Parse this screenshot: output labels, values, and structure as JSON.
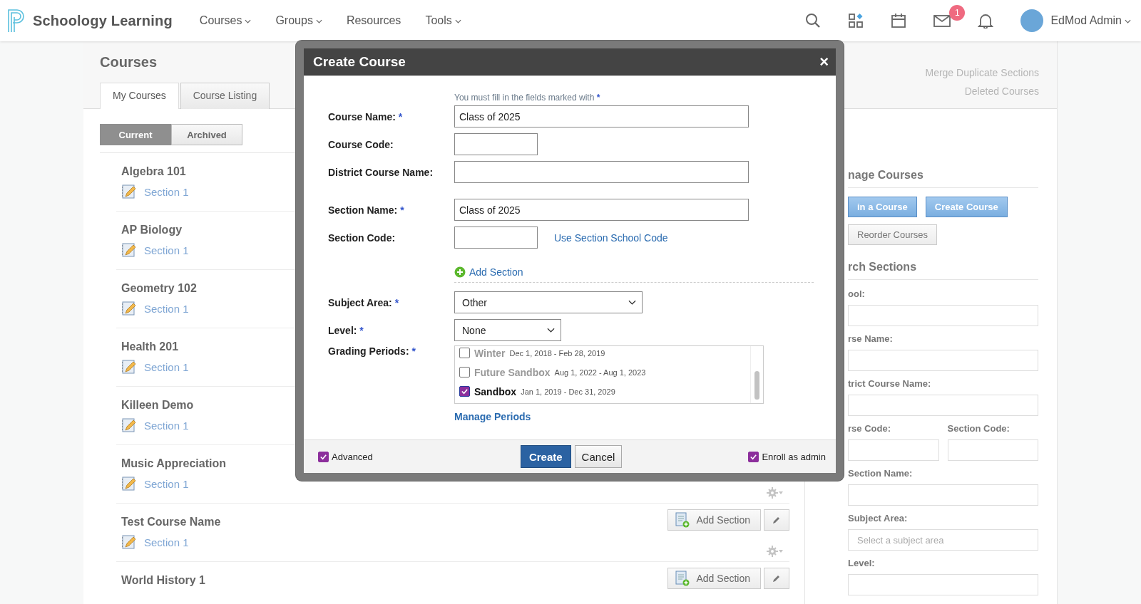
{
  "nav": {
    "brand": "Schoology Learning",
    "items": [
      {
        "label": "Courses",
        "dropdown": true
      },
      {
        "label": "Groups",
        "dropdown": true
      },
      {
        "label": "Resources",
        "dropdown": false
      },
      {
        "label": "Tools",
        "dropdown": true
      }
    ],
    "mail_badge": "1",
    "user": "EdMod Admin"
  },
  "page": {
    "title": "Courses",
    "tabs": [
      {
        "label": "My Courses",
        "selected": true
      },
      {
        "label": "Course Listing",
        "selected": false
      }
    ],
    "filters": [
      {
        "label": "Current",
        "selected": true
      },
      {
        "label": "Archived",
        "selected": false
      }
    ],
    "links": [
      "Merge Duplicate Sections",
      "Deleted Courses"
    ],
    "courses": [
      {
        "name": "Algebra 101",
        "section": "Section 1",
        "gear": false
      },
      {
        "name": "AP Biology",
        "section": "Section 1",
        "gear": false
      },
      {
        "name": "Geometry 102",
        "section": "Section 1",
        "gear": false
      },
      {
        "name": "Health 201",
        "section": "Section 1",
        "gear": false
      },
      {
        "name": "Killeen Demo",
        "section": "Section 1",
        "gear": false
      },
      {
        "name": "Music Appreciation",
        "section": "Section 1",
        "gear": true
      },
      {
        "name": "Test Course Name",
        "section": "Section 1",
        "add_section": "Add Section",
        "gear": true
      },
      {
        "name": "World History 1",
        "add_section": "Add Section",
        "gear": false
      }
    ]
  },
  "side": {
    "manage_title": "nage Courses",
    "buttons": [
      "in a Course",
      "Create Course"
    ],
    "reorder": "Reorder Courses",
    "search_title": "rch Sections",
    "fields": [
      {
        "label": "ool:",
        "kind": "full"
      },
      {
        "label": "rse Name:",
        "kind": "full"
      },
      {
        "label": "trict Course Name:",
        "kind": "full"
      },
      {
        "label": "rse Code:",
        "kind": "half"
      },
      {
        "label": "Section Code:",
        "kind": "half"
      },
      {
        "label": "Section Name:",
        "kind": "full"
      },
      {
        "label": "Subject Area:",
        "kind": "full",
        "placeholder": "Select a subject area"
      },
      {
        "label": "Level:",
        "kind": "full"
      }
    ]
  },
  "modal": {
    "title": "Create Course",
    "close": "×",
    "note": "You must fill in the fields marked with",
    "note_mark": "*",
    "course_fields": [
      {
        "label": "Course Name:",
        "mark": "*",
        "kind": "wide",
        "value": "Class of 2025"
      },
      {
        "label": "Course Code:",
        "kind": "short"
      },
      {
        "label": "District Course Name:",
        "kind": "wide"
      }
    ],
    "section_fields": [
      {
        "label": "Section Name:",
        "mark": "*",
        "kind": "wide",
        "value": "Class of 2025"
      },
      {
        "label": "Section Code:",
        "kind": "short",
        "link": "Use Section School Code"
      }
    ],
    "add_section": "Add Section",
    "subject": {
      "label": "Subject Area:",
      "mark": "*",
      "value": "Other"
    },
    "level": {
      "label": "Level:",
      "mark": "*",
      "value": "None"
    },
    "grading": {
      "label": "Grading Periods:",
      "mark": "*",
      "periods": [
        {
          "name": "Winter",
          "dates": "Dec 1, 2018 - Feb 28, 2019",
          "checked": false
        },
        {
          "name": "Future Sandbox",
          "dates": "Aug 1, 2022 - Aug 1, 2023",
          "checked": false
        },
        {
          "name": "Sandbox",
          "dates": "Jan 1, 2019 - Dec 31, 2029",
          "checked": true
        }
      ]
    },
    "manage_periods": "Manage Periods",
    "advanced": {
      "label": "Advanced",
      "checked": true
    },
    "create": "Create",
    "cancel": "Cancel",
    "enroll": {
      "label": "Enroll as admin",
      "checked": true
    }
  }
}
